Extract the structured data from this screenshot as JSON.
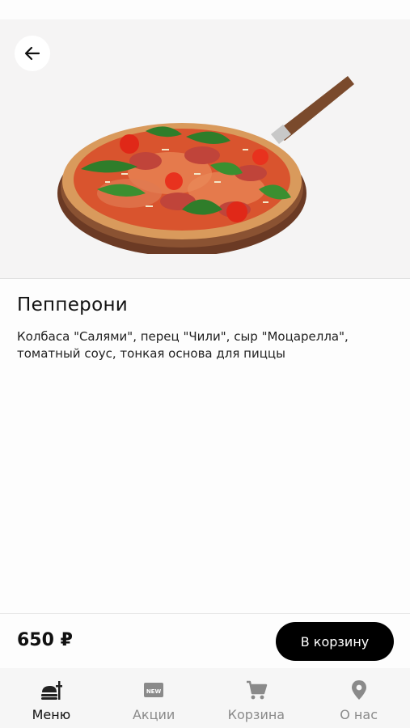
{
  "header": {
    "back_icon": "arrow-left-icon"
  },
  "product": {
    "image": "pizza-photo",
    "title": "Пепперони",
    "description": "Колбаса \"Салями\", перец \"Чили\", сыр \"Моцарелла\", томатный соус, тонкая основа для пиццы"
  },
  "cart_bar": {
    "price": "650 ₽",
    "add_button_label": "В корзину"
  },
  "tabbar": {
    "items": [
      {
        "label": "Меню",
        "icon": "food-icon",
        "active": true
      },
      {
        "label": "Акции",
        "icon": "new-badge-icon",
        "active": false
      },
      {
        "label": "Корзина",
        "icon": "cart-icon",
        "active": false
      },
      {
        "label": "О нас",
        "icon": "location-pin-icon",
        "active": false
      }
    ]
  },
  "colors": {
    "accent": "#000000",
    "inactive": "#8a8a8a",
    "background": "#fdfdfd"
  }
}
